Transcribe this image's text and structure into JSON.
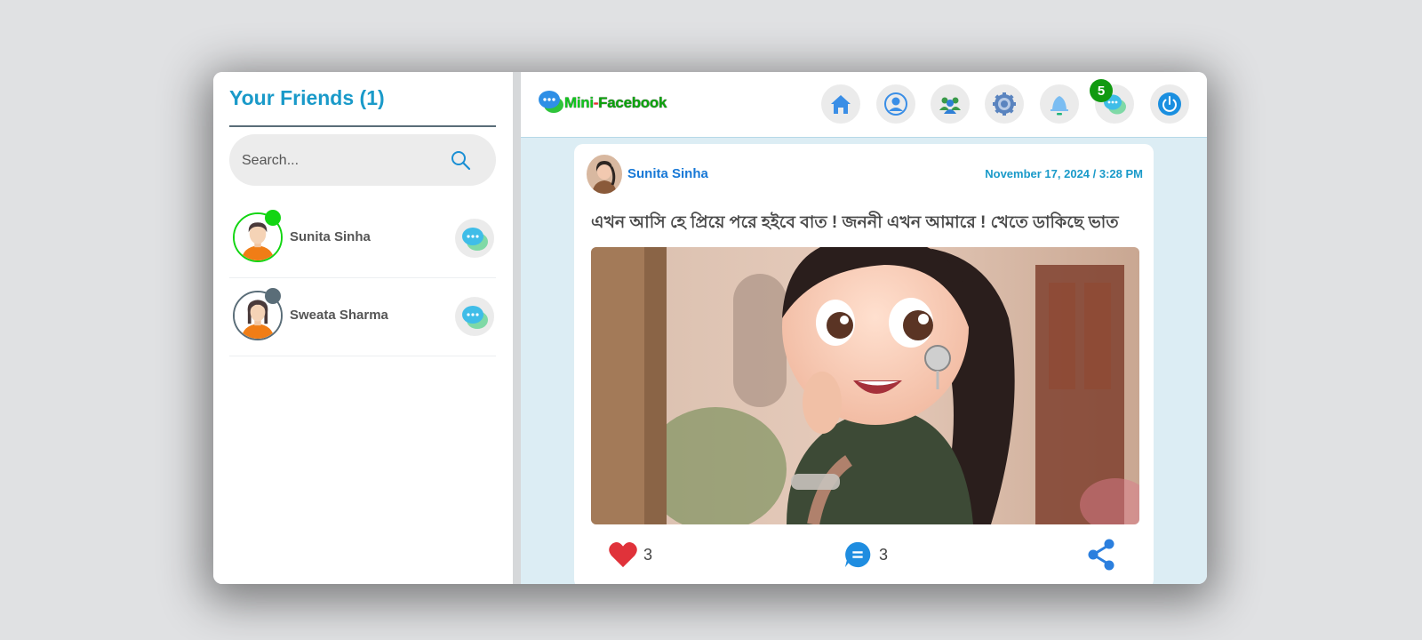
{
  "sidebar": {
    "title": "Your Friends (1)",
    "search_placeholder": "Search...",
    "friends": [
      {
        "name": "Sunita Sinha",
        "status": "online",
        "status_color": "#12d512"
      },
      {
        "name": "Sweata Sharma",
        "status": "offline",
        "status_color": "#5a6d78"
      }
    ]
  },
  "header": {
    "logo": {
      "part1": "Mini",
      "part2": "-",
      "part3": "Facebook"
    },
    "nav": [
      "home-icon",
      "profile-icon",
      "friends-icon",
      "settings-icon",
      "notifications-icon",
      "messages-icon",
      "power-icon"
    ],
    "message_badge": "5"
  },
  "post": {
    "author": "Sunita Sinha",
    "date": "November 17, 2024 / 3:28 PM",
    "text": "এখন আসি হে প্রিয়ে পরে হইবে বাত ! জননী এখন আমারে ! খেতে ডাকিছে ভাত",
    "likes": "3",
    "comments": "3"
  },
  "colors": {
    "accent": "#1a9ac9",
    "author_link": "#1778d6",
    "main_bg": "#dcedf4",
    "badge": "#119a11"
  }
}
